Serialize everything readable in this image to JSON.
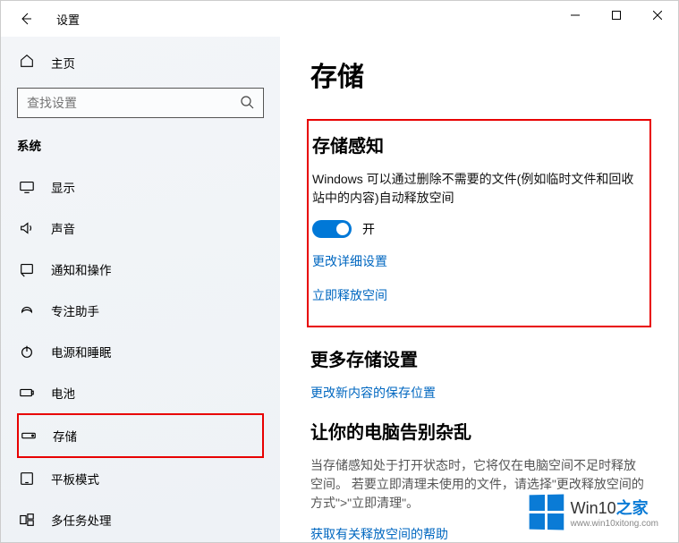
{
  "titlebar": {
    "title": "设置"
  },
  "sidebar": {
    "home": "主页",
    "search_placeholder": "查找设置",
    "category": "系统",
    "items": [
      {
        "label": "显示"
      },
      {
        "label": "声音"
      },
      {
        "label": "通知和操作"
      },
      {
        "label": "专注助手"
      },
      {
        "label": "电源和睡眠"
      },
      {
        "label": "电池"
      },
      {
        "label": "存储"
      },
      {
        "label": "平板模式"
      },
      {
        "label": "多任务处理"
      }
    ]
  },
  "main": {
    "title": "存储",
    "sense": {
      "heading": "存储感知",
      "desc": "Windows 可以通过删除不需要的文件(例如临时文件和回收站中的内容)自动释放空间",
      "toggle_state": "开",
      "link1": "更改详细设置",
      "link2": "立即释放空间"
    },
    "more": {
      "heading": "更多存储设置",
      "link": "更改新内容的保存位置"
    },
    "clutter": {
      "heading": "让你的电脑告别杂乱",
      "desc": "当存储感知处于打开状态时，它将仅在电脑空间不足时释放空间。 若要立即清理未使用的文件，请选择\"更改释放空间的方式\">\"立即清理\"。",
      "link": "获取有关释放空间的帮助"
    }
  },
  "watermark": {
    "line1_a": "Win10",
    "line1_b": "之家",
    "line2": "www.win10xitong.com"
  }
}
